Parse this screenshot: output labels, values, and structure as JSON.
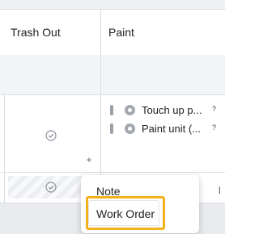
{
  "table": {
    "columns": [
      {
        "label": "Trash Out"
      },
      {
        "label": "Paint"
      }
    ],
    "paint_tasks": [
      {
        "label": "Touch up p...",
        "help": "?"
      },
      {
        "label": "Paint unit (...",
        "help": "?"
      }
    ],
    "row_edge_text": "l"
  },
  "context_menu": {
    "items": [
      {
        "label": "Note"
      },
      {
        "label": "Work Order"
      }
    ],
    "highlighted": "Work Order"
  },
  "icons": {
    "status_check": "check-circle-icon",
    "add": "plus-icon",
    "task_status": "radio-dot-icon",
    "drag": "drag-handle-icon",
    "help": "help-icon"
  },
  "colors": {
    "highlight_border": "#f3b21b",
    "grid_line": "#d9dde3",
    "band": "#f3f4f6"
  }
}
